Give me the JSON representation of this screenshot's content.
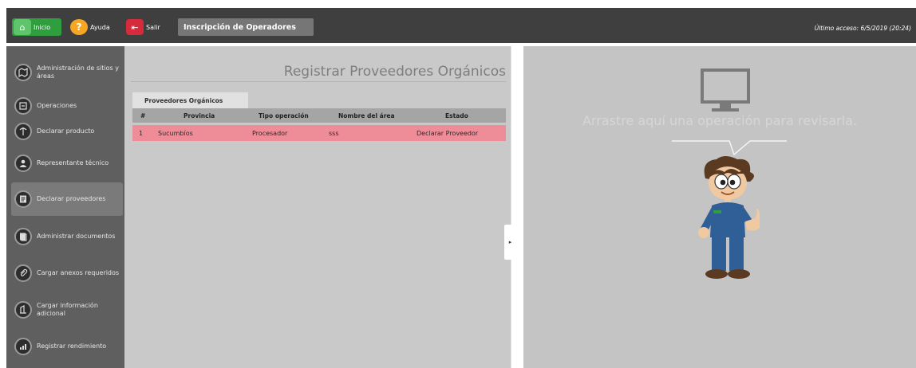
{
  "topbar": {
    "inicio_label": "Inicio",
    "ayuda_label": "Ayuda",
    "salir_label": "Salir",
    "inscripcion_label": "Inscripción de Operadores",
    "ultimo_acceso": "Último acceso: 6/5/2019 (20:24)"
  },
  "sidebar": {
    "items": [
      {
        "label": "Administración de sitios y áreas",
        "icon": "map-icon"
      },
      {
        "label": "Operaciones",
        "icon": "operations-icon"
      },
      {
        "label": "Declarar producto",
        "icon": "product-icon"
      },
      {
        "label": "Representante técnico",
        "icon": "technician-icon"
      },
      {
        "label": "Declarar proveedores",
        "icon": "providers-icon",
        "active": true
      },
      {
        "label": "Administrar documentos",
        "icon": "documents-icon"
      },
      {
        "label": "Cargar anexos requeridos",
        "icon": "attachment-icon"
      },
      {
        "label": "Cargar información adicional",
        "icon": "info-icon"
      },
      {
        "label": "Registrar rendimiento",
        "icon": "chart-icon"
      }
    ]
  },
  "main": {
    "title": "Registrar Proveedores Orgánicos",
    "tab_label": "Proveedores Orgánicos",
    "columns": [
      "#",
      "Provincia",
      "Tipo operación",
      "Nombre del área",
      "Estado"
    ],
    "rows": [
      [
        "1",
        "Sucumbíos",
        "Procesador",
        "sss",
        "Declarar Proveedor"
      ]
    ]
  },
  "right": {
    "drop_text": "Arrastre aquí una operación para revisarla."
  },
  "colors": {
    "topbar_bg": "#3f3f3f",
    "inicio_green": "#2f9e3f",
    "ayuda_orange": "#f5a623",
    "salir_red": "#d62b3a",
    "row_highlight": "#ee8d98"
  }
}
